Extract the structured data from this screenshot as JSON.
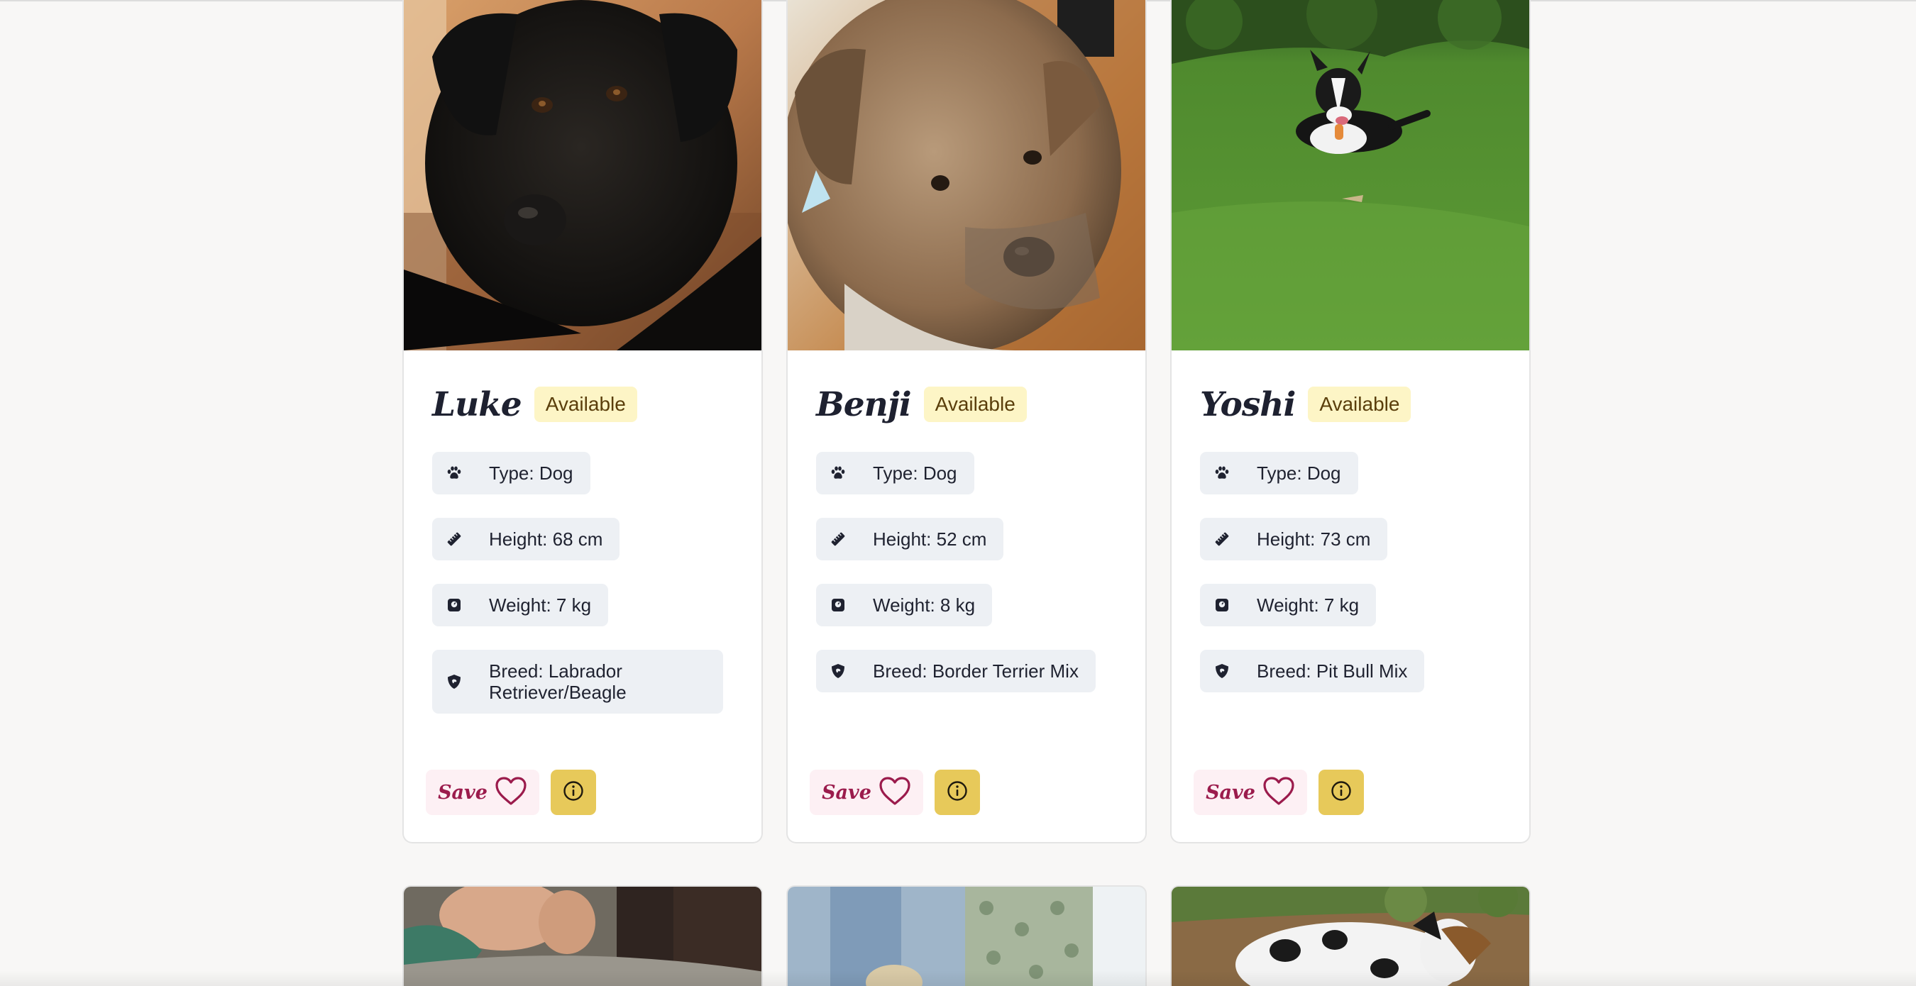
{
  "cards": [
    {
      "name": "Luke",
      "status": "Available",
      "type": "Type: Dog",
      "height": "Height: 68 cm",
      "weight": "Weight: 7 kg",
      "breed": "Breed: Labrador Retriever/Beagle",
      "save_label": "Save"
    },
    {
      "name": "Benji",
      "status": "Available",
      "type": "Type: Dog",
      "height": "Height: 52 cm",
      "weight": "Weight: 8 kg",
      "breed": "Breed: Border Terrier Mix",
      "save_label": "Save"
    },
    {
      "name": "Yoshi",
      "status": "Available",
      "type": "Type: Dog",
      "height": "Height: 73 cm",
      "weight": "Weight: 7 kg",
      "breed": "Breed: Pit Bull Mix",
      "save_label": "Save"
    }
  ],
  "icons": {
    "type": "paw-icon",
    "height": "ruler-icon",
    "weight": "scale-icon",
    "breed": "shield-dog-icon",
    "save": "heart-outline-icon",
    "info": "info-circle-icon"
  },
  "colors": {
    "page_bg": "#f8f7f6",
    "badge_bg": "#fdf5c6",
    "badge_text": "#5a3e0b",
    "chip_bg": "#edf0f4",
    "save_bg": "#fdf0f4",
    "save_text": "#9b1b4c",
    "info_bg": "#e7c95a"
  }
}
